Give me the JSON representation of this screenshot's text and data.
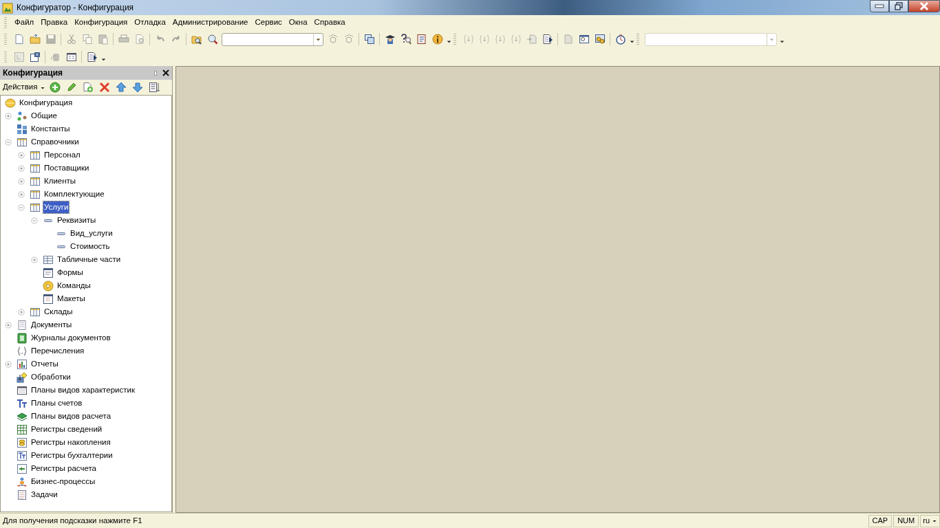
{
  "window": {
    "title": "Конфигуратор - Конфигурация"
  },
  "menu": [
    {
      "label": "Файл"
    },
    {
      "label": "Правка"
    },
    {
      "label": "Конфигурация"
    },
    {
      "label": "Отладка"
    },
    {
      "label": "Администрирование"
    },
    {
      "label": "Сервис"
    },
    {
      "label": "Окна"
    },
    {
      "label": "Справка"
    }
  ],
  "toolbars": [
    {
      "buttons": [
        {
          "kind": "new",
          "disabled": false
        },
        {
          "kind": "open",
          "disabled": false
        },
        {
          "kind": "save",
          "disabled": true
        },
        {
          "kind": "separator"
        },
        {
          "kind": "cut",
          "disabled": true
        },
        {
          "kind": "copy",
          "disabled": true
        },
        {
          "kind": "paste",
          "disabled": true
        },
        {
          "kind": "separator"
        },
        {
          "kind": "print",
          "disabled": true
        },
        {
          "kind": "preview",
          "disabled": true
        },
        {
          "kind": "separator"
        },
        {
          "kind": "undo",
          "disabled": true
        },
        {
          "kind": "redo",
          "disabled": true
        },
        {
          "kind": "separator"
        },
        {
          "kind": "find-folder",
          "disabled": false
        },
        {
          "kind": "search",
          "disabled": false
        },
        {
          "kind": "combo",
          "disabled": false
        },
        {
          "kind": "find-next",
          "disabled": true
        },
        {
          "kind": "find-prev",
          "disabled": true
        },
        {
          "kind": "separator"
        },
        {
          "kind": "windows",
          "disabled": false
        },
        {
          "kind": "separator"
        },
        {
          "kind": "wizard",
          "disabled": false
        },
        {
          "kind": "help-search",
          "disabled": false
        },
        {
          "kind": "syntax",
          "disabled": false
        },
        {
          "kind": "info",
          "disabled": false
        },
        {
          "kind": "dropdown",
          "disabled": false
        },
        {
          "kind": "grip"
        },
        {
          "kind": "step",
          "disabled": true
        },
        {
          "kind": "step",
          "disabled": true
        },
        {
          "kind": "step",
          "disabled": true
        },
        {
          "kind": "step",
          "disabled": true
        },
        {
          "kind": "run",
          "disabled": true
        },
        {
          "kind": "start",
          "disabled": false
        },
        {
          "kind": "separator"
        },
        {
          "kind": "page",
          "disabled": true
        },
        {
          "kind": "window-search",
          "disabled": false
        },
        {
          "kind": "gears",
          "disabled": false
        },
        {
          "kind": "separator"
        },
        {
          "kind": "timer",
          "disabled": false
        },
        {
          "kind": "dropdown",
          "disabled": false
        },
        {
          "kind": "grip"
        },
        {
          "kind": "combo-wide",
          "disabled": true
        },
        {
          "kind": "dropdown",
          "disabled": false
        }
      ]
    },
    {
      "buttons": [
        {
          "kind": "tree",
          "disabled": true
        },
        {
          "kind": "window-x",
          "disabled": false
        },
        {
          "kind": "separator"
        },
        {
          "kind": "database",
          "disabled": true
        },
        {
          "kind": "table-form",
          "disabled": false
        },
        {
          "kind": "separator"
        },
        {
          "kind": "start",
          "disabled": false
        },
        {
          "kind": "dropdown",
          "disabled": false
        }
      ]
    }
  ],
  "panel": {
    "title": "Конфигурация",
    "actions_label": "Действия",
    "actions": [
      {
        "kind": "add"
      },
      {
        "kind": "edit"
      },
      {
        "kind": "copy-add"
      },
      {
        "kind": "delete"
      },
      {
        "kind": "up"
      },
      {
        "kind": "down"
      },
      {
        "kind": "sort"
      }
    ],
    "tree": [
      {
        "label": "Конфигурация",
        "kind": "config",
        "selected": false,
        "children": [
          {
            "label": "Общие",
            "kind": "common",
            "expanded": false,
            "selected": false
          },
          {
            "label": "Константы",
            "kind": "constants",
            "selected": false
          },
          {
            "label": "Справочники",
            "kind": "catalog",
            "expanded": true,
            "selected": false,
            "children": [
              {
                "label": "Персонал",
                "kind": "catalog",
                "expanded": false,
                "selected": false
              },
              {
                "label": "Поставщики",
                "kind": "catalog",
                "expanded": false,
                "selected": false
              },
              {
                "label": "Клиенты",
                "kind": "catalog",
                "expanded": false,
                "selected": false
              },
              {
                "label": "Комплектующие",
                "kind": "catalog",
                "expanded": false,
                "selected": false
              },
              {
                "label": "Услуги",
                "kind": "catalog",
                "expanded": true,
                "selected": true,
                "children": [
                  {
                    "label": "Реквизиты",
                    "kind": "attribute",
                    "expanded": true,
                    "selected": false,
                    "children": [
                      {
                        "label": "Вид_услуги",
                        "kind": "attribute",
                        "selected": false
                      },
                      {
                        "label": "Стоимость",
                        "kind": "attribute",
                        "selected": false
                      }
                    ]
                  },
                  {
                    "label": "Табличные части",
                    "kind": "tabular",
                    "expanded": false,
                    "selected": false
                  },
                  {
                    "label": "Формы",
                    "kind": "forms",
                    "selected": false
                  },
                  {
                    "label": "Команды",
                    "kind": "commands",
                    "selected": false
                  },
                  {
                    "label": "Макеты",
                    "kind": "layouts",
                    "selected": false
                  }
                ]
              },
              {
                "label": "Склады",
                "kind": "catalog",
                "expanded": false,
                "selected": false
              }
            ]
          },
          {
            "label": "Документы",
            "kind": "documents",
            "expanded": false,
            "selected": false
          },
          {
            "label": "Журналы документов",
            "kind": "journals",
            "selected": false
          },
          {
            "label": "Перечисления",
            "kind": "enums",
            "selected": false
          },
          {
            "label": "Отчеты",
            "kind": "reports",
            "expanded": false,
            "selected": false
          },
          {
            "label": "Обработки",
            "kind": "processing",
            "selected": false
          },
          {
            "label": "Планы видов характеристик",
            "kind": "chars",
            "selected": false
          },
          {
            "label": "Планы счетов",
            "kind": "accounts",
            "selected": false
          },
          {
            "label": "Планы видов расчета",
            "kind": "calc-plans",
            "selected": false
          },
          {
            "label": "Регистры сведений",
            "kind": "info-reg",
            "selected": false
          },
          {
            "label": "Регистры накопления",
            "kind": "accum-reg",
            "selected": false
          },
          {
            "label": "Регистры бухгалтерии",
            "kind": "acc-reg",
            "selected": false
          },
          {
            "label": "Регистры расчета",
            "kind": "calc-reg",
            "selected": false
          },
          {
            "label": "Бизнес-процессы",
            "kind": "bp",
            "selected": false
          },
          {
            "label": "Задачи",
            "kind": "tasks",
            "selected": false
          }
        ]
      }
    ]
  },
  "status_bar": {
    "hint": "Для получения подсказки нажмите F1",
    "indicators": [
      "CAP",
      "NUM"
    ],
    "language": "ru"
  }
}
